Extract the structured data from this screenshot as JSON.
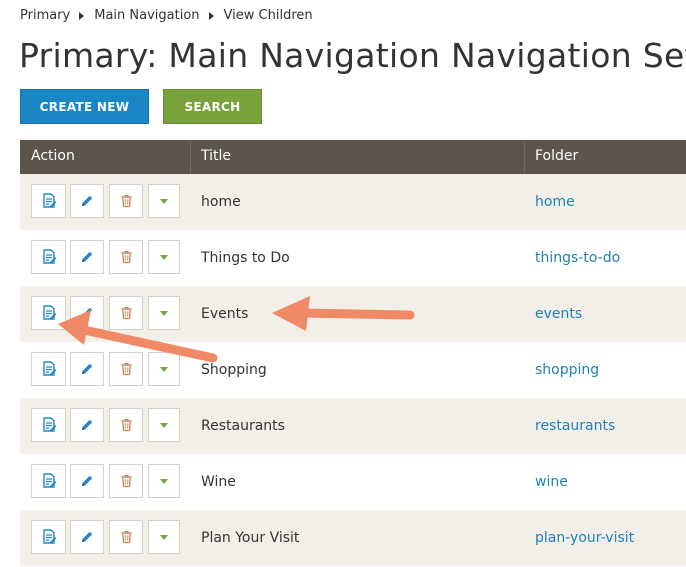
{
  "breadcrumb": {
    "items": [
      "Primary",
      "Main Navigation",
      "View Children"
    ]
  },
  "page": {
    "title": "Primary: Main Navigation Navigation Set"
  },
  "toolbar": {
    "create_label": "CREATE NEW",
    "search_label": "SEARCH"
  },
  "table": {
    "headers": {
      "action": "Action",
      "title": "Title",
      "folder": "Folder"
    },
    "rows": [
      {
        "title": "home",
        "folder": "home"
      },
      {
        "title": "Things to Do",
        "folder": "things-to-do"
      },
      {
        "title": "Events",
        "folder": "events"
      },
      {
        "title": "Shopping",
        "folder": "shopping"
      },
      {
        "title": "Restaurants",
        "folder": "restaurants"
      },
      {
        "title": "Wine",
        "folder": "wine"
      },
      {
        "title": "Plan Your Visit",
        "folder": "plan-your-visit"
      }
    ]
  },
  "icons": {
    "edit_content": "edit-document-icon",
    "edit": "pencil-icon",
    "delete": "trash-icon",
    "more": "chevron-down-icon"
  },
  "colors": {
    "primary_blue": "#1a86c6",
    "search_green": "#79a23b",
    "header_bg": "#5b554d",
    "stripe_bg": "#f2efe9",
    "link": "#1f7fb8",
    "delete_icon": "#c9825a",
    "annotation_arrow": "#f08a66"
  }
}
